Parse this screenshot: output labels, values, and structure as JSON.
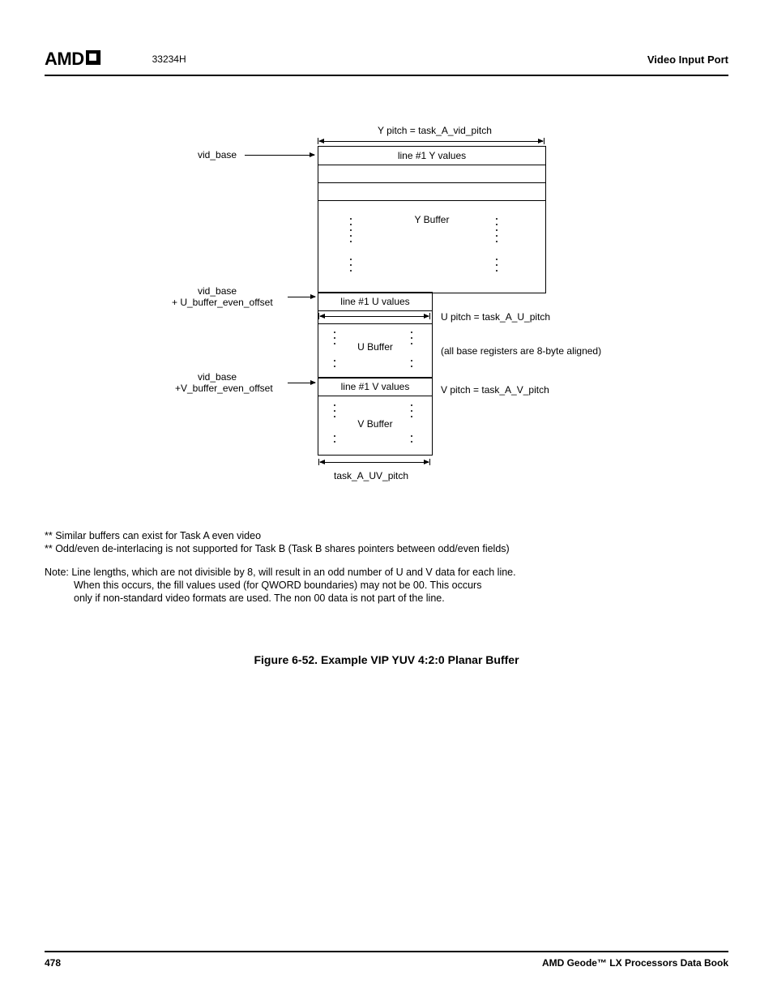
{
  "header": {
    "logo_text": "AMD",
    "doc_number": "33234H",
    "section": "Video Input Port"
  },
  "diagram": {
    "y_pitch_label": "Y pitch = task_A_vid_pitch",
    "vid_base": "vid_base",
    "line1_y": "line #1 Y values",
    "y_buffer": "Y Buffer",
    "vid_base_u_line1": "vid_base",
    "vid_base_u_line2": "+ U_buffer_even_offset",
    "line1_u": "line #1 U values",
    "u_pitch_label": "U pitch = task_A_U_pitch",
    "u_buffer": "U Buffer",
    "align_note": "(all base registers are 8-byte aligned)",
    "vid_base_v_line1": "vid_base",
    "vid_base_v_line2": "+V_buffer_even_offset",
    "line1_v": "line #1 V values",
    "v_pitch_label": "V pitch = task_A_V_pitch",
    "v_buffer": "V Buffer",
    "uv_pitch_label": "task_A_UV_pitch"
  },
  "notes": {
    "star1": "** Similar buffers can exist for Task A even video",
    "star2": "** Odd/even de-interlacing is not supported for Task B (Task B shares pointers between odd/even fields)",
    "note_label": "Note:",
    "note_line1": "Line lengths, which are not divisible by 8, will result in an odd number of U and V data for each line.",
    "note_line2": "When this occurs, the fill values used (for QWORD boundaries) may not be 00. This occurs",
    "note_line3": "only if non-standard video formats are used. The non 00 data is not part of the line."
  },
  "figure_caption": "Figure 6-52.  Example VIP YUV 4:2:0 Planar Buffer",
  "footer": {
    "page_number": "478",
    "book_title": "AMD Geode™ LX Processors Data Book"
  }
}
